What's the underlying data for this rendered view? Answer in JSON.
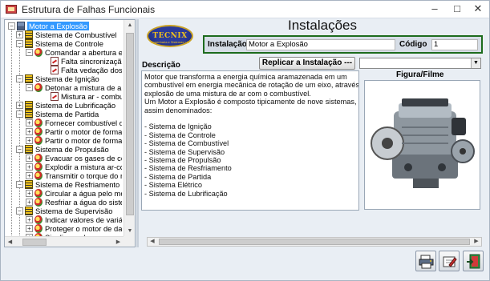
{
  "window": {
    "title": "Estrutura de Falhas Funcionais",
    "minimize": "–",
    "maximize": "□",
    "close": "✕"
  },
  "tree": {
    "nodes": [
      {
        "label": "Motor a Explosão",
        "icon": "engine-root-icon",
        "selected": true
      },
      {
        "label": "Sistema de Combustível",
        "icon": "system-icon"
      },
      {
        "label": "Sistema de Controle",
        "icon": "system-icon"
      },
      {
        "label": "Comandar a abertura e fe",
        "icon": "function-icon"
      },
      {
        "label": "Falta sincronização no",
        "icon": "failure-icon"
      },
      {
        "label": "Falta vedação dos cili",
        "icon": "failure-icon"
      },
      {
        "label": "Sistema de Ignição",
        "icon": "system-icon"
      },
      {
        "label": "Detonar a mistura de ar-co",
        "icon": "function-icon"
      },
      {
        "label": "Mistura ar - combustív",
        "icon": "failure-icon"
      },
      {
        "label": "Sistema de Lubrificação",
        "icon": "system-icon"
      },
      {
        "label": "Sistema de Partida",
        "icon": "system-icon"
      },
      {
        "label": "Fornecer combustível dur",
        "icon": "function-icon"
      },
      {
        "label": "Partir o motor de forma au",
        "icon": "function-icon"
      },
      {
        "label": "Partir o motor de forma ma",
        "icon": "function-icon"
      },
      {
        "label": "Sistema de Propulsão",
        "icon": "system-icon"
      },
      {
        "label": "Evacuar os gases de com",
        "icon": "function-icon"
      },
      {
        "label": "Explodir a mistura ar-com",
        "icon": "function-icon"
      },
      {
        "label": "Transmitir o torque do mo",
        "icon": "function-icon"
      },
      {
        "label": "Sistema de Resfriamento",
        "icon": "system-icon"
      },
      {
        "label": "Circular a água pelo mot",
        "icon": "function-icon"
      },
      {
        "label": "Resfriar a água do sistem",
        "icon": "function-icon"
      },
      {
        "label": "Sistema de Supervisão",
        "icon": "system-icon"
      },
      {
        "label": "Indicar valores de variáve",
        "icon": "function-icon"
      },
      {
        "label": "Proteger o motor de dano",
        "icon": "function-icon"
      },
      {
        "label": "Sinalizar valores anormai",
        "icon": "function-icon"
      }
    ]
  },
  "logo": {
    "text": "TECNIX",
    "subtext": "Engenharia e Sistemas Ltd"
  },
  "heading": "Instalações",
  "form": {
    "instalacao_label": "Instalação",
    "instalacao_value": "Motor a Explosão",
    "codigo_label": "Código",
    "codigo_value": "1",
    "descricao_label": "Descrição",
    "replicar_label": "Replicar a Instalação --->",
    "replicar_select_value": "",
    "figura_label": "Figura/Filme"
  },
  "description": {
    "lines": [
      "Motor que transforma a energia química aramazenada em um",
      "combustível em energia mecânica de rotação de um eixo, através da",
      "explosão de uma mistura de ar com o combustível.",
      "Um Motor a Explosão é composto tipicamente de nove sistemas,",
      "assim denominados:",
      "",
      "- Sistema de Ignição",
      "- Sistema de Controle",
      "- Sistema de Combustível",
      "- Sistema de Supervisão",
      "- Sistema de Propulsão",
      "- Sistema de Resfriamento",
      "- Sistema de Partida",
      "- Sistema Elétrico",
      "- Sistema de Lubrificação"
    ]
  },
  "actions": {
    "print_icon": "print-icon",
    "edit_icon": "edit-icon",
    "exit_icon": "exit-door-icon"
  },
  "colors": {
    "selection": "#3399ff",
    "installation_border": "#1d6b1d",
    "panel_bg": "#e9eef4"
  }
}
